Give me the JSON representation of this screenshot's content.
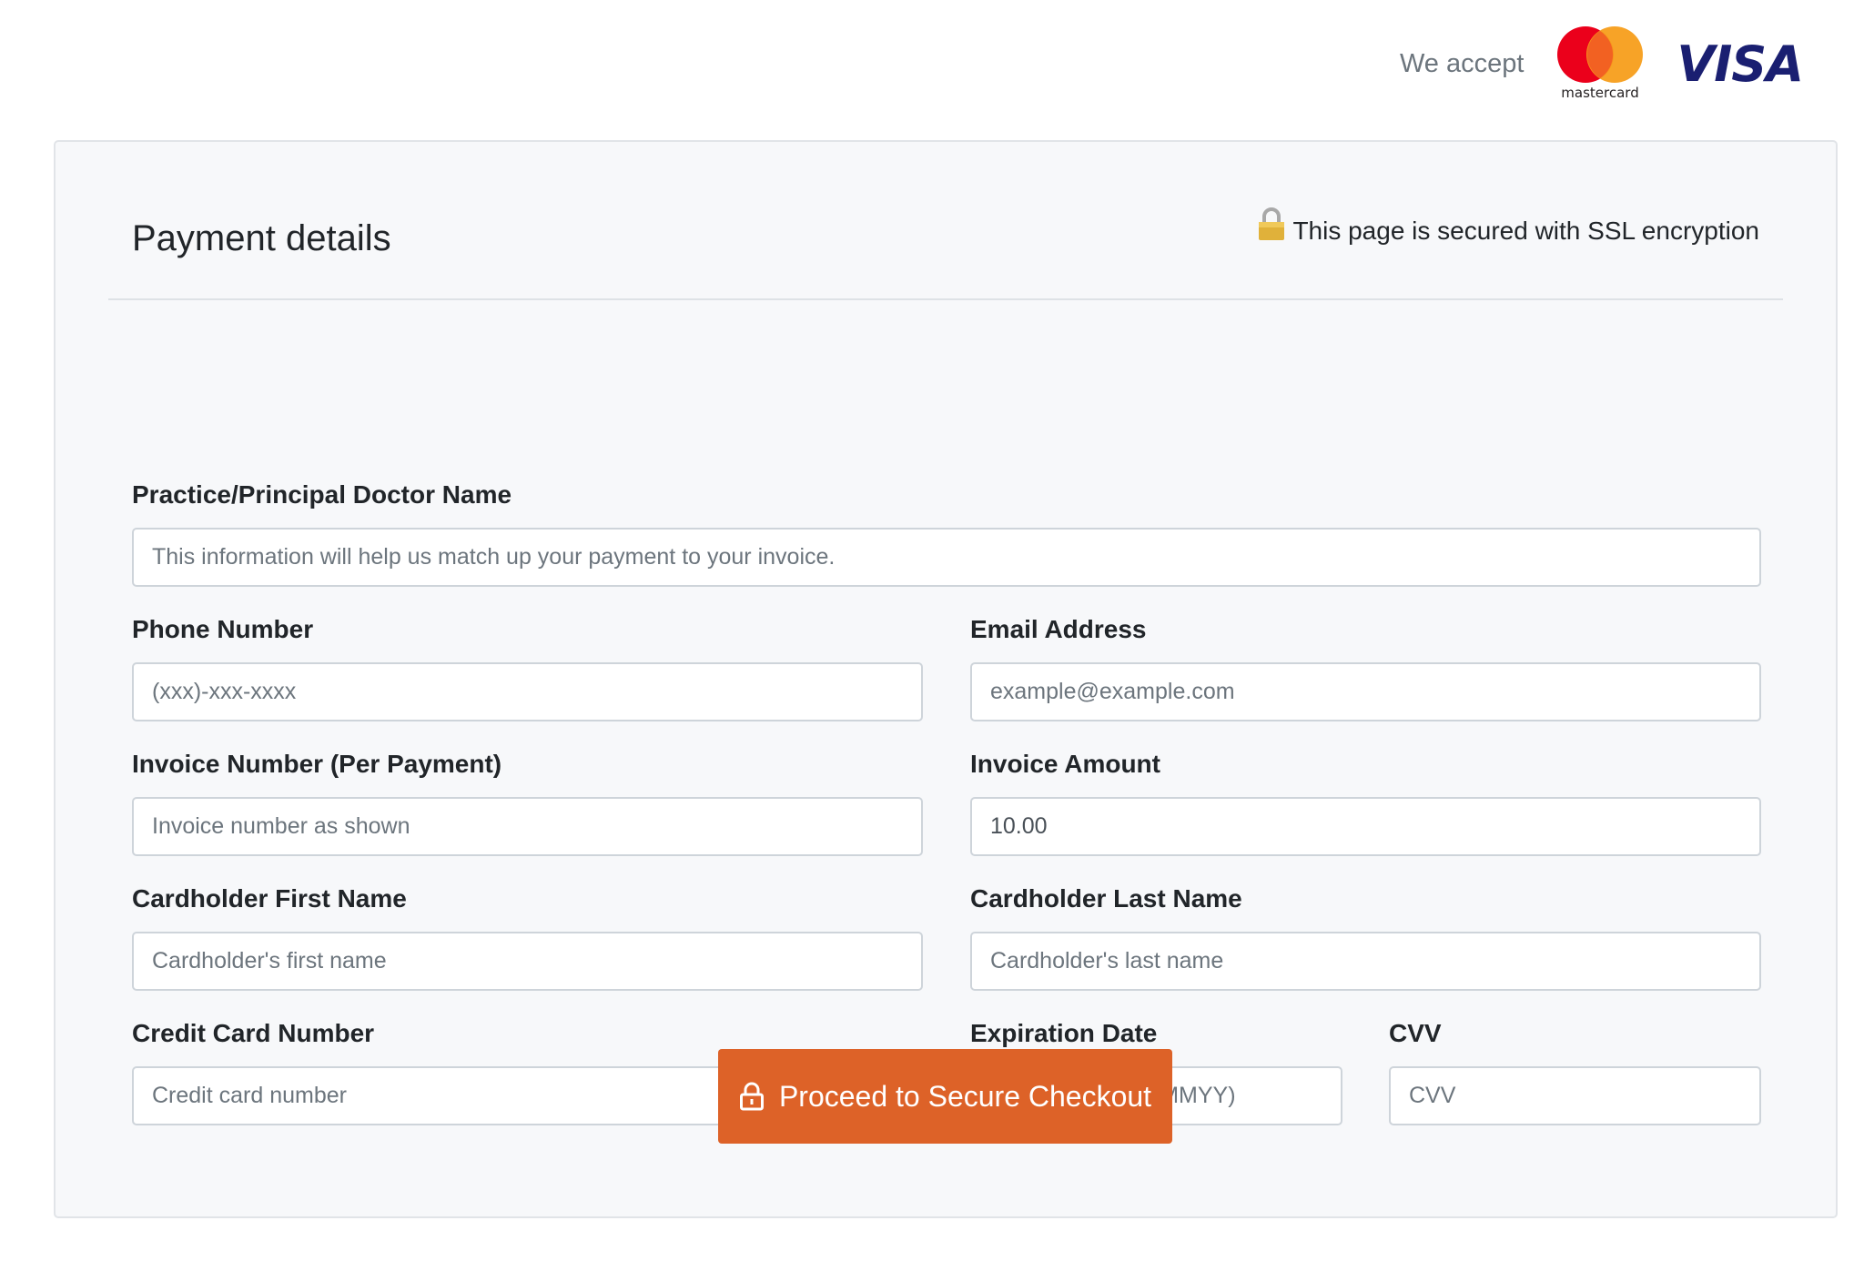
{
  "header": {
    "accept_text": "We accept",
    "mastercard_label": "mastercard",
    "visa_label": "VISA"
  },
  "card": {
    "title": "Payment details",
    "ssl_text": "This page is secured with SSL encryption"
  },
  "form": {
    "practice": {
      "label": "Practice/Principal Doctor Name",
      "placeholder": "This information will help us match up your payment to your invoice."
    },
    "phone": {
      "label": "Phone Number",
      "placeholder": "(xxx)-xxx-xxxx"
    },
    "email": {
      "label": "Email Address",
      "placeholder": "example@example.com"
    },
    "invoice_number": {
      "label": "Invoice Number (Per Payment)",
      "placeholder": "Invoice number as shown"
    },
    "invoice_amount": {
      "label": "Invoice Amount",
      "value": "10.00"
    },
    "first_name": {
      "label": "Cardholder First Name",
      "placeholder": "Cardholder's first name"
    },
    "last_name": {
      "label": "Cardholder Last Name",
      "placeholder": "Cardholder's last name"
    },
    "card_number": {
      "label": "Credit Card Number",
      "placeholder": "Credit card number"
    },
    "expiration": {
      "label": "Expiration Date",
      "placeholder": "Expiration Date (MMYY)"
    },
    "cvv": {
      "label": "CVV",
      "placeholder": "CVV"
    },
    "submit_label": "Proceed to Secure Checkout"
  },
  "colors": {
    "accent": "#dd6228",
    "mastercard_red": "#eb001b",
    "mastercard_orange": "#f79e1b",
    "visa_blue": "#1a1f71",
    "ssl_lock": "#e0b13a"
  },
  "icons": {
    "ssl": "padlock-icon",
    "button": "unlock-icon"
  }
}
